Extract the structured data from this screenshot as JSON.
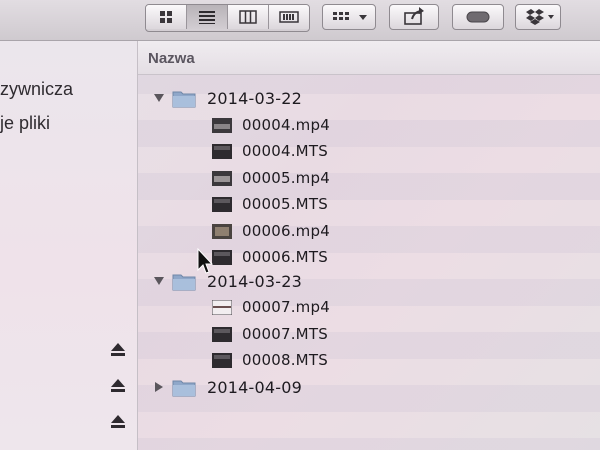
{
  "column": {
    "name_header": "Nazwa"
  },
  "sidebar": {
    "items": [
      {
        "label": "zywnicza"
      },
      {
        "label": "je pliki"
      }
    ],
    "eject_icons": [
      "eject-icon",
      "eject-icon",
      "eject-icon"
    ]
  },
  "toolbar": {
    "buttons": [
      "icon-view-icon",
      "list-view-icon",
      "column-view-icon",
      "cover-flow-view-icon",
      "arrange-icon",
      "share-icon",
      "tag-icon",
      "dropbox-icon"
    ]
  },
  "files": {
    "groups": [
      {
        "folder": "2014-03-22",
        "expanded": true,
        "items": [
          "00004.mp4",
          "00004.MTS",
          "00005.mp4",
          "00005.MTS",
          "00006.mp4",
          "00006.MTS"
        ]
      },
      {
        "folder": "2014-03-23",
        "expanded": true,
        "items": [
          "00007.mp4",
          "00007.MTS",
          "00008.MTS"
        ]
      },
      {
        "folder": "2014-04-09",
        "expanded": false,
        "items": []
      }
    ]
  }
}
